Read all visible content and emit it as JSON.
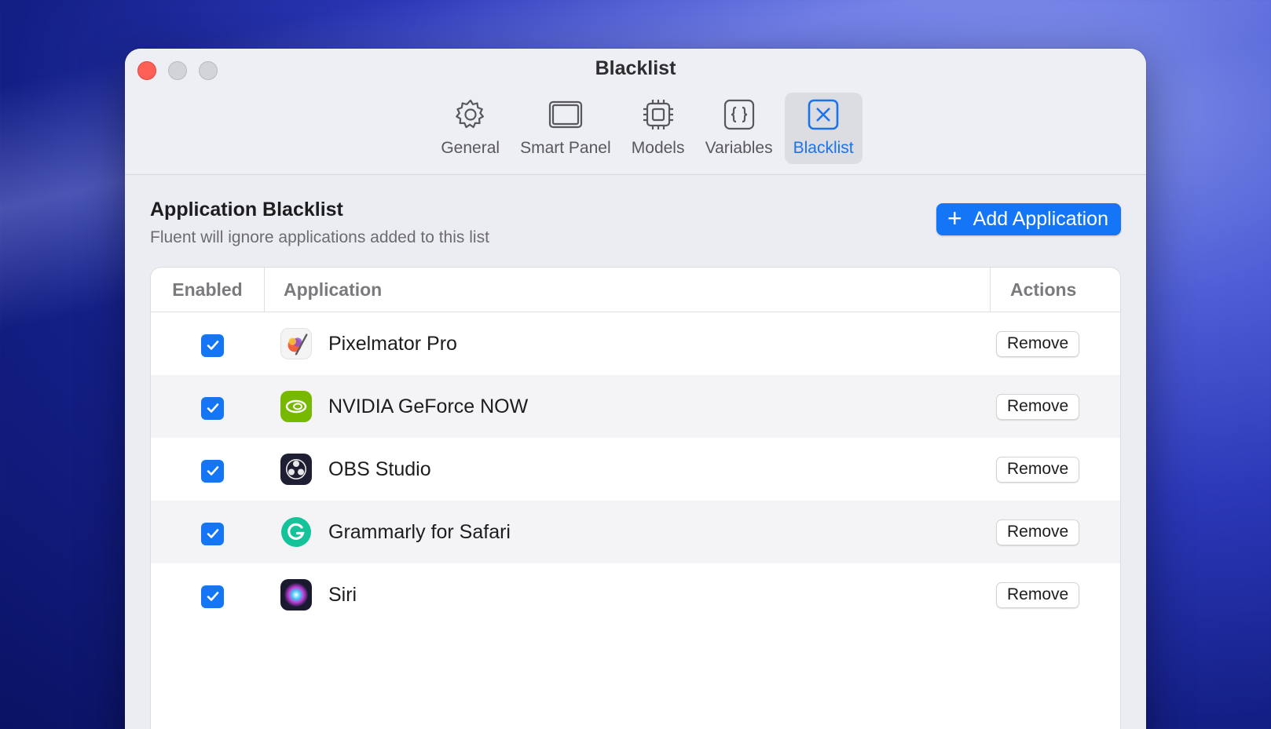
{
  "window": {
    "title": "Blacklist"
  },
  "toolbar": {
    "items": [
      {
        "label": "General",
        "icon": "gear-icon",
        "active": false
      },
      {
        "label": "Smart Panel",
        "icon": "panel-icon",
        "active": false
      },
      {
        "label": "Models",
        "icon": "chip-icon",
        "active": false
      },
      {
        "label": "Variables",
        "icon": "braces-icon",
        "active": false
      },
      {
        "label": "Blacklist",
        "icon": "x-square-icon",
        "active": true
      }
    ]
  },
  "section": {
    "title": "Application Blacklist",
    "subtitle": "Fluent will ignore applications added to this list",
    "add_button": "Add Application"
  },
  "table": {
    "headers": {
      "enabled": "Enabled",
      "application": "Application",
      "actions": "Actions"
    },
    "rows": [
      {
        "enabled": true,
        "name": "Pixelmator Pro",
        "icon": "pixelmator-icon",
        "action": "Remove"
      },
      {
        "enabled": true,
        "name": "NVIDIA GeForce NOW",
        "icon": "nvidia-icon",
        "action": "Remove"
      },
      {
        "enabled": true,
        "name": "OBS Studio",
        "icon": "obs-icon",
        "action": "Remove"
      },
      {
        "enabled": true,
        "name": "Grammarly for Safari",
        "icon": "grammarly-icon",
        "action": "Remove"
      },
      {
        "enabled": true,
        "name": "Siri",
        "icon": "siri-icon",
        "action": "Remove"
      }
    ]
  },
  "colors": {
    "accent": "#1476f6",
    "close": "#fe5f57"
  }
}
